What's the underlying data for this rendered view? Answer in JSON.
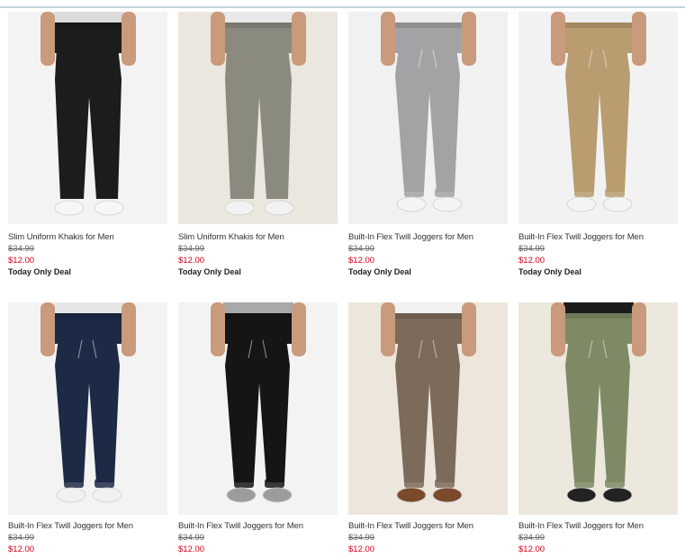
{
  "products": [
    {
      "name": "Slim Uniform Khakis for Men",
      "original_price": "$34.99",
      "sale_price": "$12.00",
      "deal": "Today Only Deal",
      "style": "chino",
      "pant_color": "#1c1c1c",
      "bg": "#f3f3f3",
      "shirt": "#dcdcdc",
      "shoe": "#f7f7f7",
      "skin": "#c99a7b"
    },
    {
      "name": "Slim Uniform Khakis for Men",
      "original_price": "$34.99",
      "sale_price": "$12.00",
      "deal": "Today Only Deal",
      "style": "chino",
      "pant_color": "#8b8a7f",
      "bg": "#ece7de",
      "shirt": "#e9e9e9",
      "shoe": "#f2f2f2",
      "skin": "#c99a7b"
    },
    {
      "name": "Built-In Flex Twill Joggers for Men",
      "original_price": "$34.99",
      "sale_price": "$12.00",
      "deal": "Today Only Deal",
      "style": "jogger",
      "pant_color": "#a3a3a6",
      "bg": "#f1f1f1",
      "shirt": "#eeeeee",
      "shoe": "#f4f4f4",
      "skin": "#c99a7b"
    },
    {
      "name": "Built-In Flex Twill Joggers for Men",
      "original_price": "$34.99",
      "sale_price": "$12.00",
      "deal": "Today Only Deal",
      "style": "jogger",
      "pant_color": "#b99c6f",
      "bg": "#f2f2f2",
      "shirt": "#efefef",
      "shoe": "#f4f4f4",
      "skin": "#c99a7b"
    },
    {
      "name": "Built-In Flex Twill Joggers for Men",
      "original_price": "$34.99",
      "sale_price": "$12.00",
      "deal": "",
      "style": "jogger",
      "pant_color": "#1d2a46",
      "bg": "#f3f3f3",
      "shirt": "#e6e6e6",
      "shoe": "#f1f1f1",
      "skin": "#c99a7b"
    },
    {
      "name": "Built-In Flex Twill Joggers for Men",
      "original_price": "$34.99",
      "sale_price": "$12.00",
      "deal": "",
      "style": "jogger",
      "pant_color": "#151515",
      "bg": "#f3f3f3",
      "shirt": "#a9a9a9",
      "shoe": "#9c9c9c",
      "skin": "#c99a7b"
    },
    {
      "name": "Built-In Flex Twill Joggers for Men",
      "original_price": "$34.99",
      "sale_price": "$12.00",
      "deal": "",
      "style": "jogger",
      "pant_color": "#7c6a5a",
      "bg": "#ece6dc",
      "shirt": "#f1f1f1",
      "shoe": "#7b4a2c",
      "skin": "#c99a7b"
    },
    {
      "name": "Built-In Flex Twill Joggers for Men",
      "original_price": "$34.99",
      "sale_price": "$12.00",
      "deal": "",
      "style": "jogger",
      "pant_color": "#7e8a66",
      "bg": "#ece8dd",
      "shirt": "#1b1b1b",
      "shoe": "#222222",
      "skin": "#c99a7b"
    }
  ]
}
